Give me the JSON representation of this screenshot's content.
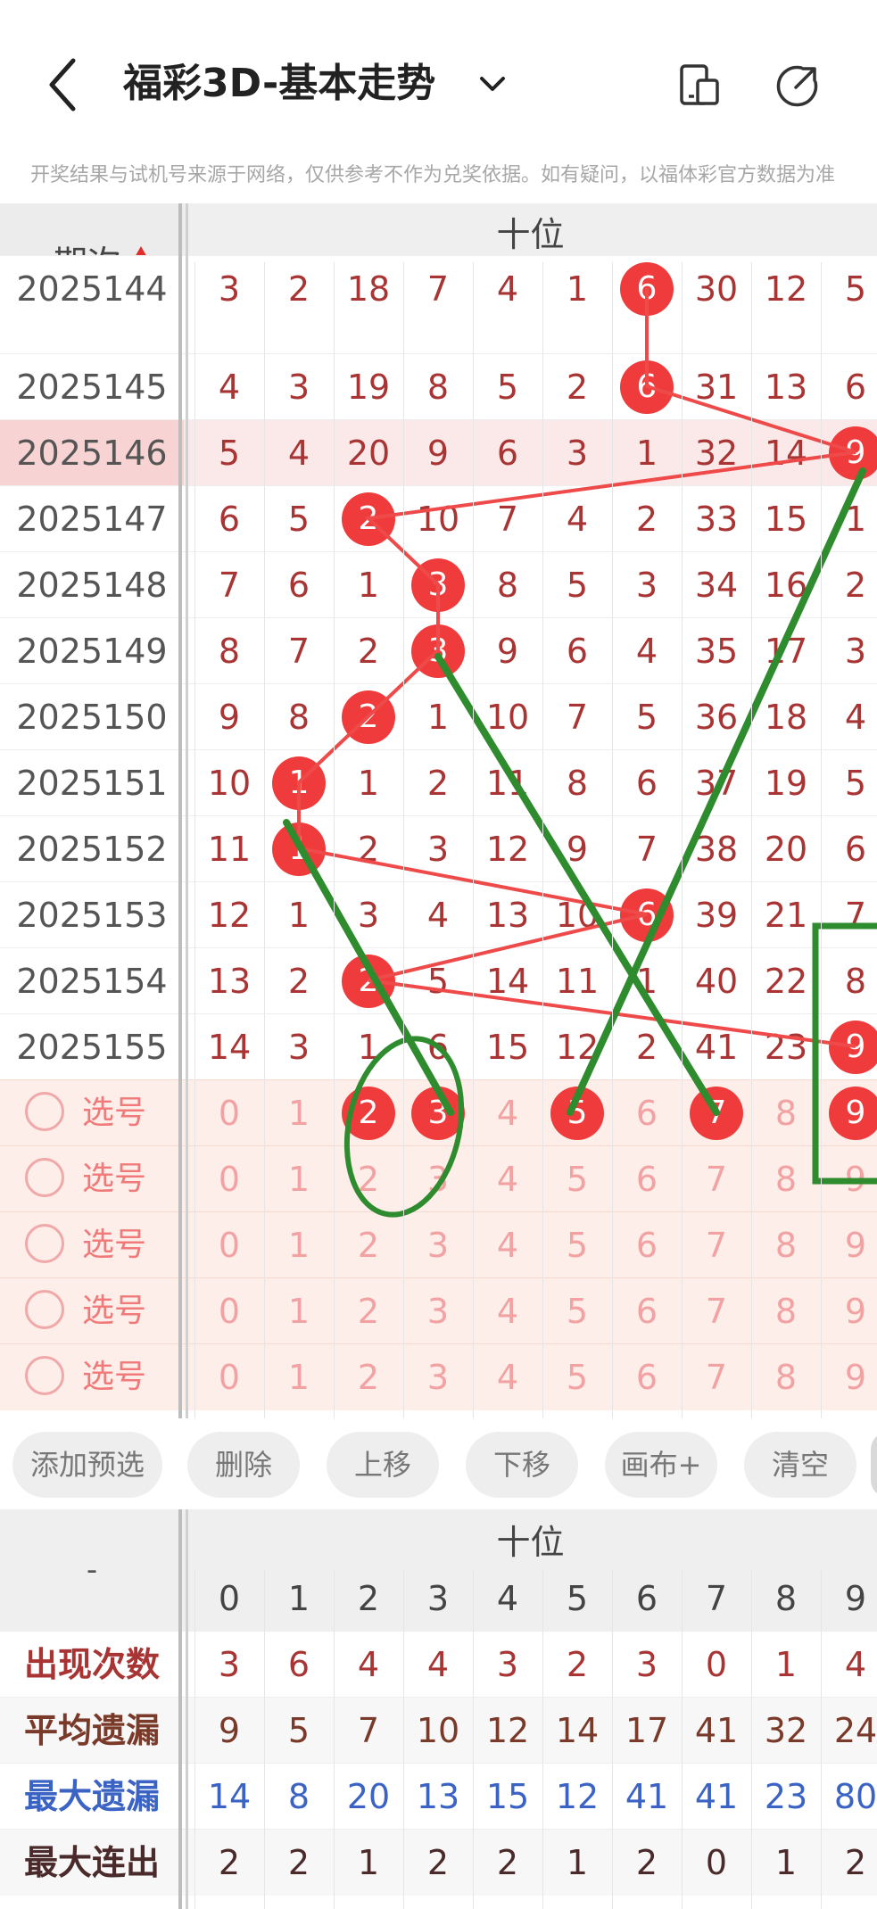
{
  "header": {
    "title": "福彩3D-基本走势"
  },
  "disclaimer": "开奖结果与试机号来源于网络，仅供参考不作为兑奖依据。如有疑问，以福体彩官方数据为准",
  "table": {
    "issue_header": "期次",
    "group_label": "十位",
    "digits": [
      "0",
      "1",
      "2",
      "3",
      "4",
      "5",
      "6",
      "7",
      "8",
      "9"
    ],
    "rows": [
      {
        "issue": "2025144",
        "cells": [
          "3",
          "2",
          "18",
          "7",
          "4",
          "1",
          "6",
          "30",
          "12",
          "5"
        ],
        "hit": 6
      },
      {
        "issue": "2025145",
        "cells": [
          "4",
          "3",
          "19",
          "8",
          "5",
          "2",
          "6",
          "31",
          "13",
          "6"
        ],
        "hit": 6
      },
      {
        "issue": "2025146",
        "cells": [
          "5",
          "4",
          "20",
          "9",
          "6",
          "3",
          "1",
          "32",
          "14",
          "9"
        ],
        "hit": 9
      },
      {
        "issue": "2025147",
        "cells": [
          "6",
          "5",
          "2",
          "10",
          "7",
          "4",
          "2",
          "33",
          "15",
          "1"
        ],
        "hit": 2
      },
      {
        "issue": "2025148",
        "cells": [
          "7",
          "6",
          "1",
          "3",
          "8",
          "5",
          "3",
          "34",
          "16",
          "2"
        ],
        "hit": 3
      },
      {
        "issue": "2025149",
        "cells": [
          "8",
          "7",
          "2",
          "3",
          "9",
          "6",
          "4",
          "35",
          "17",
          "3"
        ],
        "hit": 3
      },
      {
        "issue": "2025150",
        "cells": [
          "9",
          "8",
          "2",
          "1",
          "10",
          "7",
          "5",
          "36",
          "18",
          "4"
        ],
        "hit": 2
      },
      {
        "issue": "2025151",
        "cells": [
          "10",
          "1",
          "1",
          "2",
          "11",
          "8",
          "6",
          "37",
          "19",
          "5"
        ],
        "hit": 1
      },
      {
        "issue": "2025152",
        "cells": [
          "11",
          "1",
          "2",
          "3",
          "12",
          "9",
          "7",
          "38",
          "20",
          "6"
        ],
        "hit": 1
      },
      {
        "issue": "2025153",
        "cells": [
          "12",
          "1",
          "3",
          "4",
          "13",
          "10",
          "6",
          "39",
          "21",
          "7"
        ],
        "hit": 6
      },
      {
        "issue": "2025154",
        "cells": [
          "13",
          "2",
          "2",
          "5",
          "14",
          "11",
          "1",
          "40",
          "22",
          "8"
        ],
        "hit": 2
      },
      {
        "issue": "2025155",
        "cells": [
          "14",
          "3",
          "1",
          "6",
          "15",
          "12",
          "2",
          "41",
          "23",
          "9"
        ],
        "hit": 9
      }
    ],
    "select_label": "选号",
    "select_rows": [
      {
        "picked": [
          2,
          3,
          5,
          7,
          9
        ]
      },
      {
        "picked": []
      },
      {
        "picked": []
      },
      {
        "picked": []
      },
      {
        "picked": []
      }
    ]
  },
  "toolbar": {
    "buttons": [
      "添加预选",
      "删除",
      "上移",
      "下移",
      "画布+",
      "清空"
    ]
  },
  "summary": {
    "corner": "-",
    "group_label": "十位",
    "rows": [
      {
        "label": "出现次数",
        "values": [
          "3",
          "6",
          "4",
          "4",
          "3",
          "2",
          "3",
          "0",
          "1",
          "4"
        ],
        "color": "#a83434"
      },
      {
        "label": "平均遗漏",
        "values": [
          "9",
          "5",
          "7",
          "10",
          "12",
          "14",
          "17",
          "41",
          "32",
          "24"
        ],
        "color": "#7a3a2a"
      },
      {
        "label": "最大遗漏",
        "values": [
          "14",
          "8",
          "20",
          "13",
          "15",
          "12",
          "41",
          "41",
          "23",
          "80"
        ],
        "color": "#3a63c4"
      },
      {
        "label": "最大连出",
        "values": [
          "2",
          "2",
          "1",
          "2",
          "2",
          "1",
          "2",
          "0",
          "1",
          "2"
        ],
        "color": "#4a2a2a"
      }
    ]
  },
  "colors": {
    "ball": "#ef3b3b",
    "highlight_row": "#f7d3d3",
    "select_bg": "#fdeee9",
    "green_mark": "#2e8b2e"
  }
}
